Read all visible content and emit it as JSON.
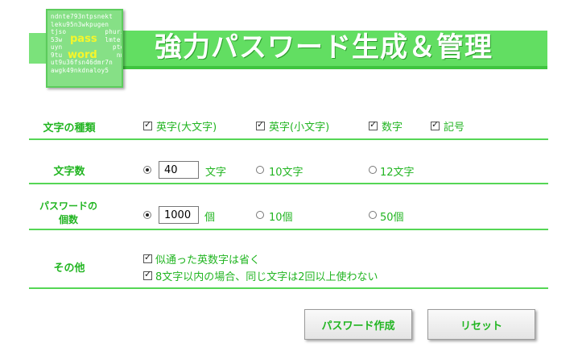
{
  "header": {
    "title": "強力パスワード生成＆管理",
    "logo": {
      "lines": [
        "ndnte793ntpsnekt",
        "leku95n3wkpugen",
        "tjso          phuri",
        "53w           lmte",
        "uyn             ptoie",
        "9tu              nnpt",
        "ut9u36fsn46dmr7n",
        "awgk49nkdnaloy5"
      ],
      "word1": "pass",
      "word2": "word"
    }
  },
  "char_types": {
    "label": "文字の種類",
    "options": [
      {
        "label": "英字(大文字)",
        "checked": true
      },
      {
        "label": "英字(小文字)",
        "checked": true
      },
      {
        "label": "数字",
        "checked": true
      },
      {
        "label": "記号",
        "checked": true
      }
    ]
  },
  "char_count": {
    "label": "文字数",
    "custom_value": "40",
    "custom_unit": "文字",
    "option_10": "10文字",
    "option_12": "12文字",
    "selected": "custom"
  },
  "pw_count": {
    "label_line1": "パスワードの",
    "label_line2": "個数",
    "custom_value": "1000",
    "custom_unit": "個",
    "option_10": "10個",
    "option_50": "50個",
    "selected": "custom"
  },
  "other": {
    "label": "その他",
    "options": [
      {
        "label": "似通った英数字は省く",
        "checked": true
      },
      {
        "label": "8文字以内の場合、同じ文字は2回以上使わない",
        "checked": true
      }
    ]
  },
  "buttons": {
    "generate": "パスワード作成",
    "reset": "リセット"
  },
  "colors": {
    "accent": "#22b522",
    "header_band": "#62de62",
    "logo_yellow": "#f6f62a"
  }
}
